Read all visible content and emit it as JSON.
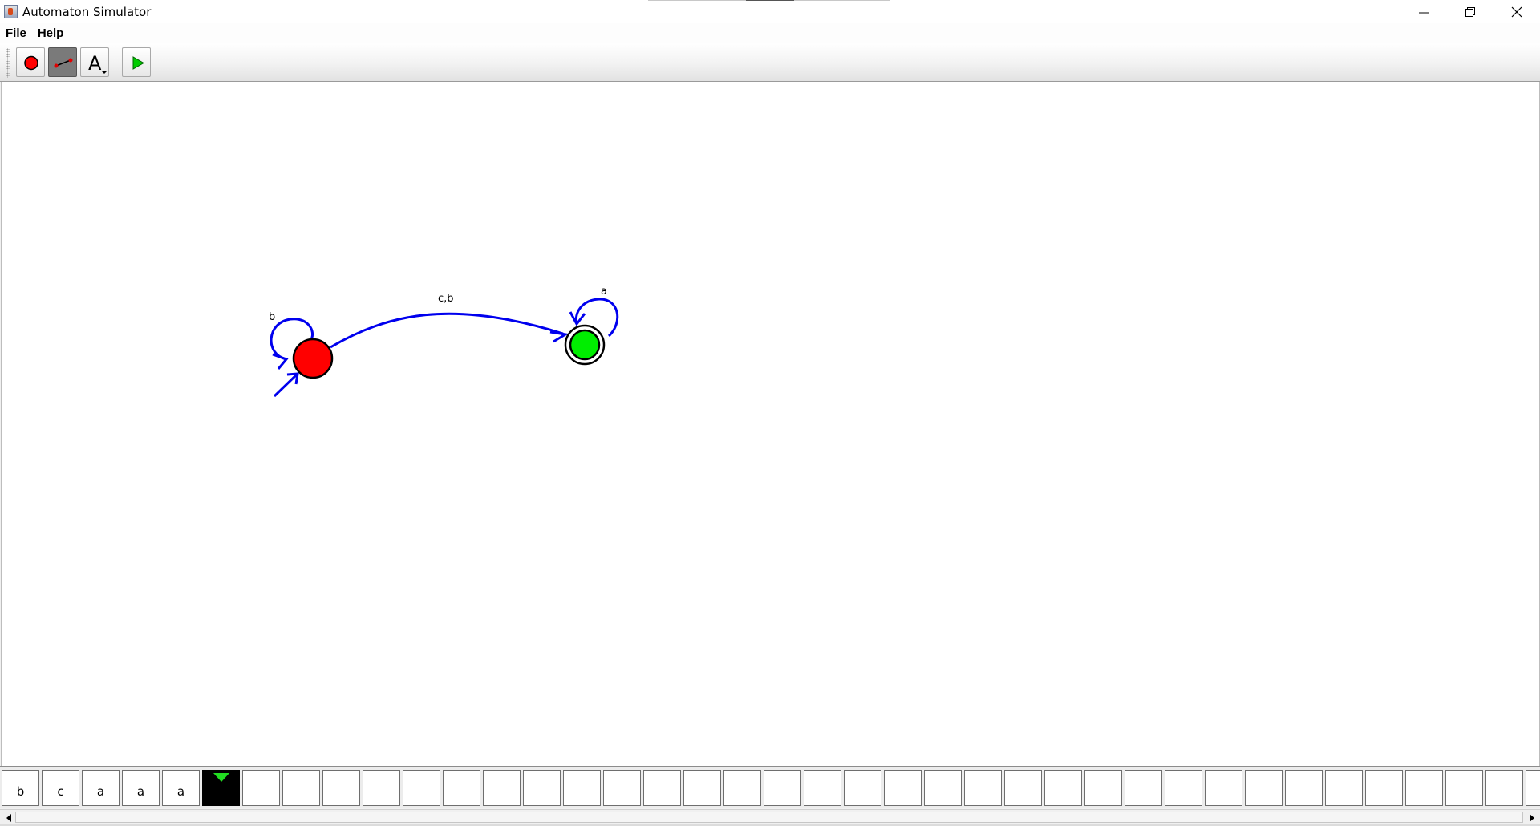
{
  "window": {
    "title": "Automaton Simulator",
    "controls": [
      "minimize-icon",
      "restore-icon",
      "close-icon"
    ]
  },
  "menu": {
    "items": [
      {
        "label": "File"
      },
      {
        "label": "Help"
      }
    ]
  },
  "toolbar": {
    "tools": [
      {
        "name": "add-state-tool",
        "icon": "red-circle-icon",
        "selected": false
      },
      {
        "name": "add-transition-tool",
        "icon": "line-icon",
        "selected": true
      },
      {
        "name": "label-tool",
        "icon": "letter-a-icon",
        "glyph": "A",
        "selected": false
      },
      {
        "name": "run-tool",
        "icon": "play-icon",
        "selected": false
      }
    ]
  },
  "automaton": {
    "states": [
      {
        "id": "q0",
        "initial": true,
        "accepting": false,
        "color": "#ff0000"
      },
      {
        "id": "q1",
        "initial": false,
        "accepting": true,
        "color": "#00ee00"
      }
    ],
    "transitions": [
      {
        "from": "q0",
        "to": "q0",
        "label": "b"
      },
      {
        "from": "q0",
        "to": "q1",
        "label": "c,b"
      },
      {
        "from": "q1",
        "to": "q1",
        "label": "a"
      }
    ],
    "edge_color": "#0000ee"
  },
  "tape": {
    "cells": [
      "b",
      "c",
      "a",
      "a",
      "a",
      "",
      "",
      "",
      "",
      "",
      "",
      "",
      "",
      "",
      "",
      "",
      "",
      "",
      "",
      "",
      "",
      "",
      "",
      "",
      "",
      "",
      "",
      "",
      "",
      "",
      "",
      "",
      "",
      "",
      "",
      "",
      "",
      "",
      ""
    ],
    "head_index": 5,
    "head_color": "#22dd22"
  }
}
